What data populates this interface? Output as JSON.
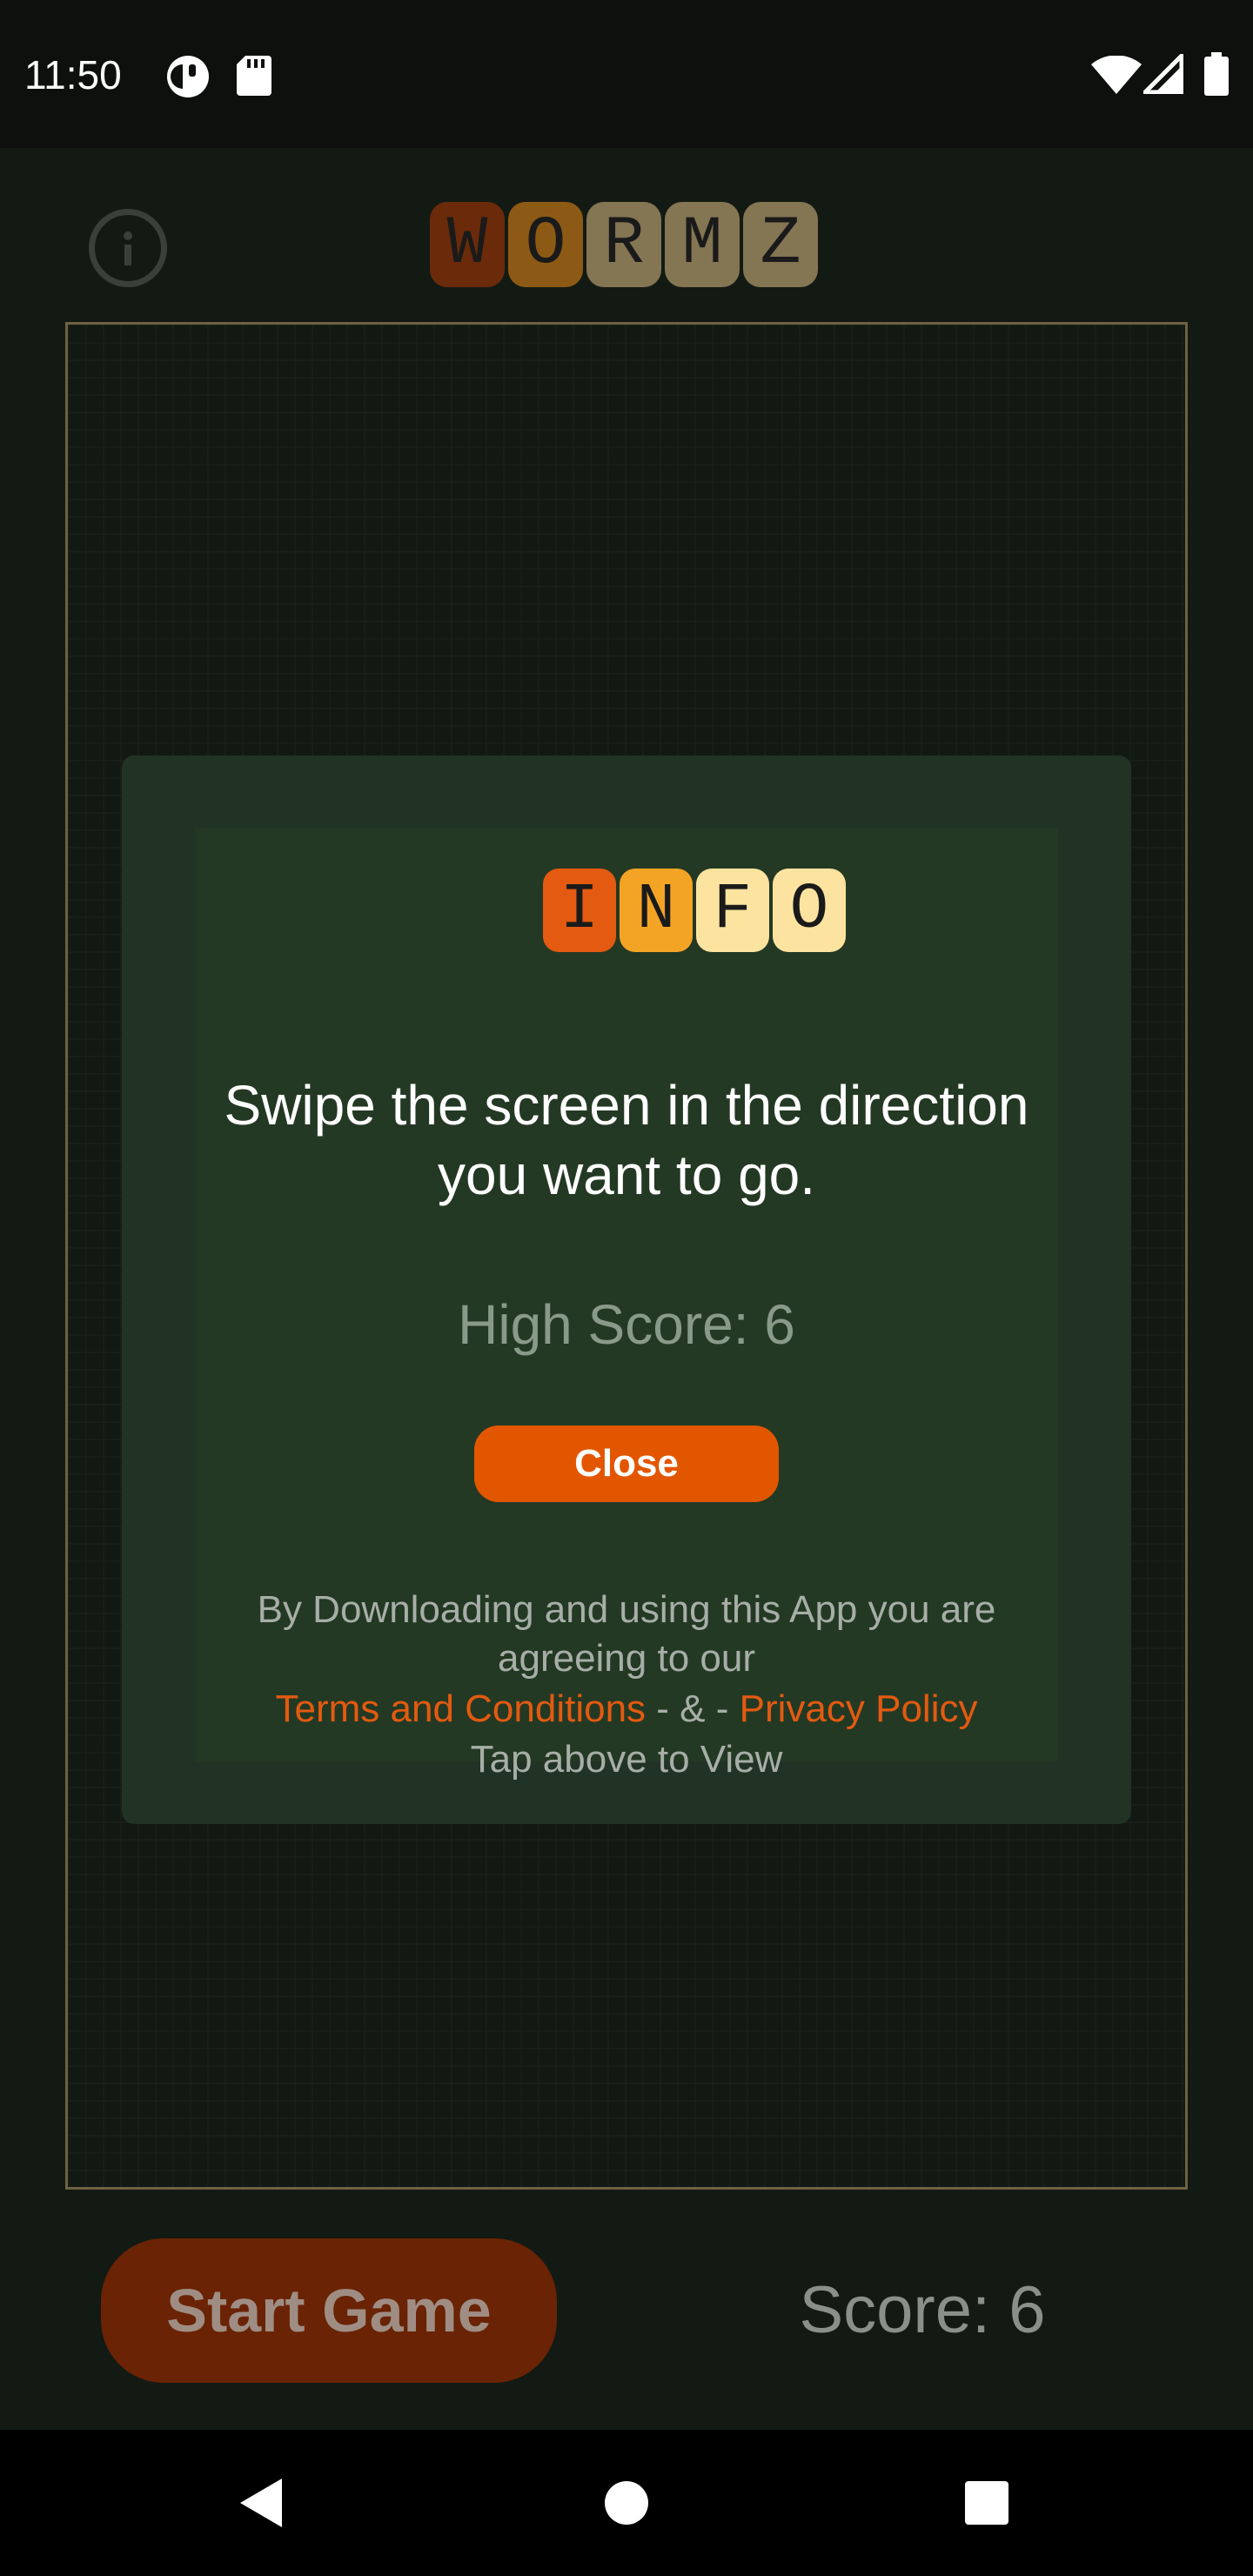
{
  "status_bar": {
    "time": "11:50",
    "left_icons": [
      "data-saver-icon",
      "sd-card-icon"
    ],
    "right_icons": [
      "wifi-icon",
      "cell-signal-icon",
      "battery-icon"
    ]
  },
  "header": {
    "info_icon": "info-circle-icon",
    "logo_letters": [
      "W",
      "O",
      "R",
      "M",
      "Z"
    ],
    "logo_colors": [
      "#6b2a09",
      "#8d5a15",
      "#847553",
      "#847553",
      "#847553"
    ]
  },
  "info_dialog": {
    "title_letters": [
      "I",
      "N",
      "F",
      "O"
    ],
    "title_colors": [
      "#e35a10",
      "#f4a424",
      "#fde3a0",
      "#fde3a0"
    ],
    "instruction": "Swipe the screen in the direction you want to go.",
    "high_score": "High Score: 6",
    "close_label": "Close",
    "legal_line": "By Downloading and using this App you are agreeing to our",
    "terms_link": "Terms and Conditions",
    "separator": " - & - ",
    "privacy_link": "Privacy Policy",
    "tap_hint": "Tap above to View"
  },
  "footer": {
    "start_label": "Start Game",
    "score": "Score: 6"
  },
  "nav_bar": {
    "icons": [
      "back-icon",
      "home-icon",
      "recents-icon"
    ]
  },
  "colors": {
    "accent": "#e35600",
    "background": "#131a14",
    "dialog": "#213324",
    "board_border": "#6f6242"
  }
}
